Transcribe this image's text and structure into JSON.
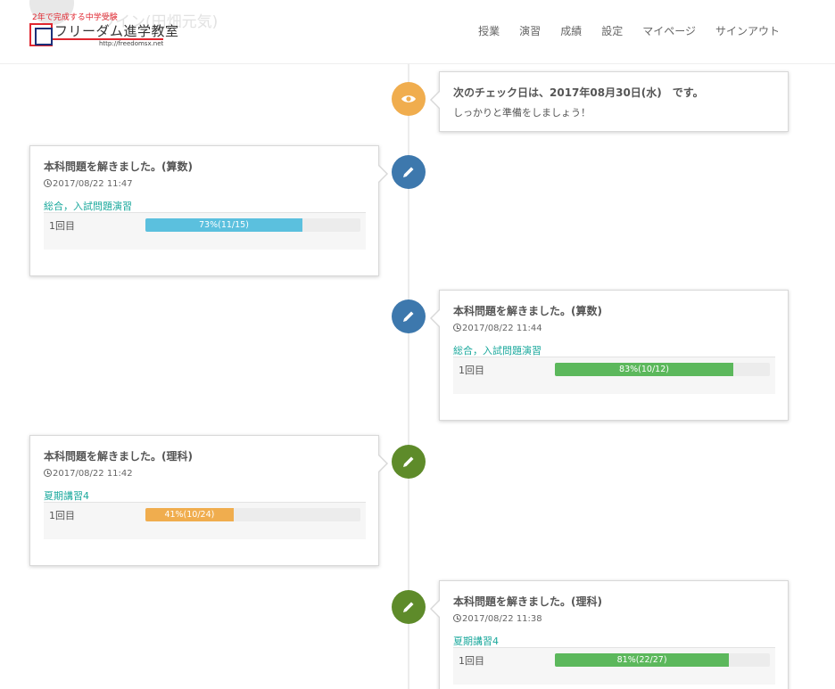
{
  "header": {
    "ghost_text": "ライン(田畑元気)",
    "logo": {
      "tagline": "2年で完成する中学受験",
      "name": "フリーダム進学教室",
      "url": "http://freedomsx.net"
    },
    "nav": [
      {
        "label": "授業"
      },
      {
        "label": "演習"
      },
      {
        "label": "成績"
      },
      {
        "label": "設定"
      },
      {
        "label": "マイページ"
      },
      {
        "label": "サインアウト"
      }
    ]
  },
  "timeline": {
    "notice": {
      "icon": "eye-icon",
      "color": "#f0ad4e",
      "title": "次のチェック日は、2017年08月30日(水)　です。",
      "body": "しっかりと準備をしましょう！"
    },
    "entries": [
      {
        "side": "left",
        "icon": "pencil-icon",
        "color": "#3d78ad",
        "title": "本科問題を解きました。(算数)",
        "time": "2017/08/22 11:47",
        "category": "総合，入試問題演習",
        "attempt": "1回目",
        "progress": 0.73,
        "progress_label": "73%(11/15)",
        "bar_color": "#5bc0de"
      },
      {
        "side": "right",
        "icon": "pencil-icon",
        "color": "#3d78ad",
        "title": "本科問題を解きました。(算数)",
        "time": "2017/08/22 11:44",
        "category": "総合，入試問題演習",
        "attempt": "1回目",
        "progress": 0.83,
        "progress_label": "83%(10/12)",
        "bar_color": "#5cb85c"
      },
      {
        "side": "left",
        "icon": "pencil-icon",
        "color": "#5e8b2a",
        "title": "本科問題を解きました。(理科)",
        "time": "2017/08/22 11:42",
        "category": "夏期講習4",
        "attempt": "1回目",
        "progress": 0.41,
        "progress_label": "41%(10/24)",
        "bar_color": "#f0ad4e"
      },
      {
        "side": "right",
        "icon": "pencil-icon",
        "color": "#5e8b2a",
        "title": "本科問題を解きました。(理科)",
        "time": "2017/08/22 11:38",
        "category": "夏期講習4",
        "attempt": "1回目",
        "progress": 0.81,
        "progress_label": "81%(22/27)",
        "bar_color": "#5cb85c"
      }
    ]
  }
}
